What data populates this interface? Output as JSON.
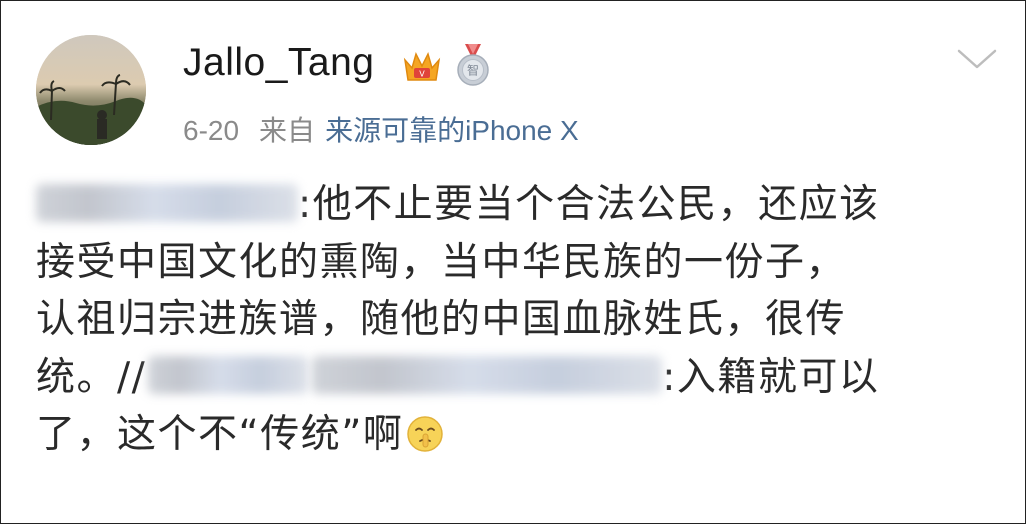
{
  "post": {
    "username": "Jallo_Tang",
    "date": "6-20",
    "from_label": "来自",
    "source": "来源可靠的iPhone X",
    "icons": {
      "crown_badge": "crown-badge-icon",
      "medal_badge": "medal-badge-icon",
      "menu": "chevron-down-icon",
      "emoji": "shh-emoji-icon"
    },
    "content": {
      "line1_text": ":他不止要当个合法公民，还应该",
      "line2_text": "接受中国文化的熏陶，当中华民族的一份子，",
      "line3_text": "认祖归宗进族谱，随他的中国血脉姓氏，很传",
      "line4_prefix": "统。//",
      "line4_text": ":入籍就可以",
      "line5_text": "了，这个不“传统”啊"
    }
  },
  "colors": {
    "username": "#1a1a1a",
    "meta_gray": "#8a8a8a",
    "source_link": "#4a6d94",
    "content_text": "#2a2a2a"
  }
}
